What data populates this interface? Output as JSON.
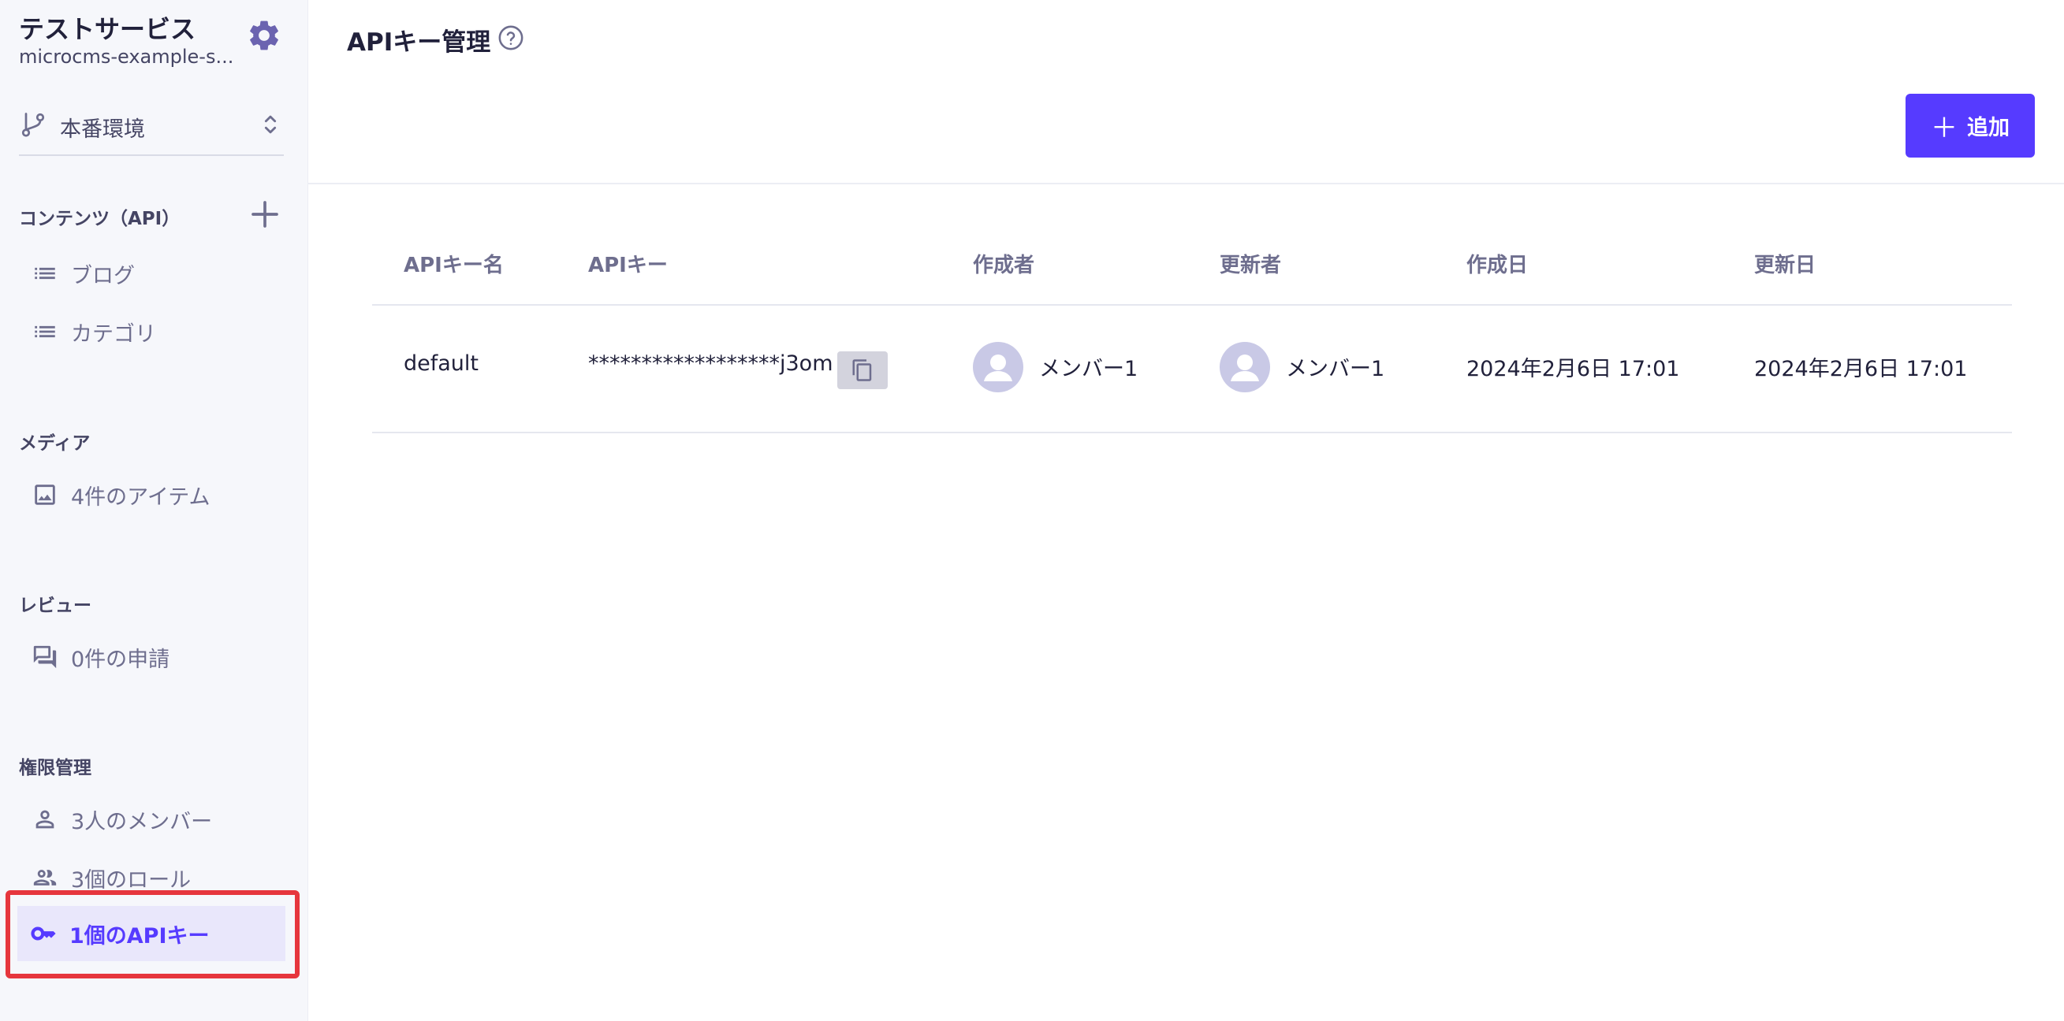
{
  "sidebar": {
    "service_name": "テストサービス",
    "service_id": "microcms-example-s...",
    "environment": "本番環境",
    "sections": {
      "content": "コンテンツ（API）",
      "media": "メディア",
      "review": "レビュー",
      "permissions": "権限管理"
    },
    "content_items": [
      "ブログ",
      "カテゴリ"
    ],
    "media_item": "4件のアイテム",
    "review_item": "0件の申請",
    "permission_items": {
      "members": "3人のメンバー",
      "roles": "3個のロール",
      "api_keys": "1個のAPIキー"
    }
  },
  "main": {
    "title": "APIキー管理",
    "add_button": "追加",
    "columns": [
      "APIキー名",
      "APIキー",
      "作成者",
      "更新者",
      "作成日",
      "更新日"
    ],
    "rows": [
      {
        "name": "default",
        "key": "******************j3om",
        "creator": "メンバー1",
        "updater": "メンバー1",
        "created": "2024年2月6日 17:01",
        "updated": "2024年2月6日 17:01"
      }
    ]
  },
  "colors": {
    "accent": "#563bff",
    "highlight": "#e6363d",
    "sidebar_bg": "#f6f7fb",
    "active_bg": "#e9e7fb"
  },
  "icons": {
    "settings": "gear-icon",
    "environment": "branch-icon",
    "environment_switch": "chevron-updown-icon",
    "add_api": "plus-icon",
    "list": "list-icon",
    "media": "image-icon",
    "review": "chat-icon",
    "member": "person-icon",
    "role": "people-icon",
    "api_key": "key-icon",
    "help": "help-icon",
    "copy": "copy-icon"
  }
}
